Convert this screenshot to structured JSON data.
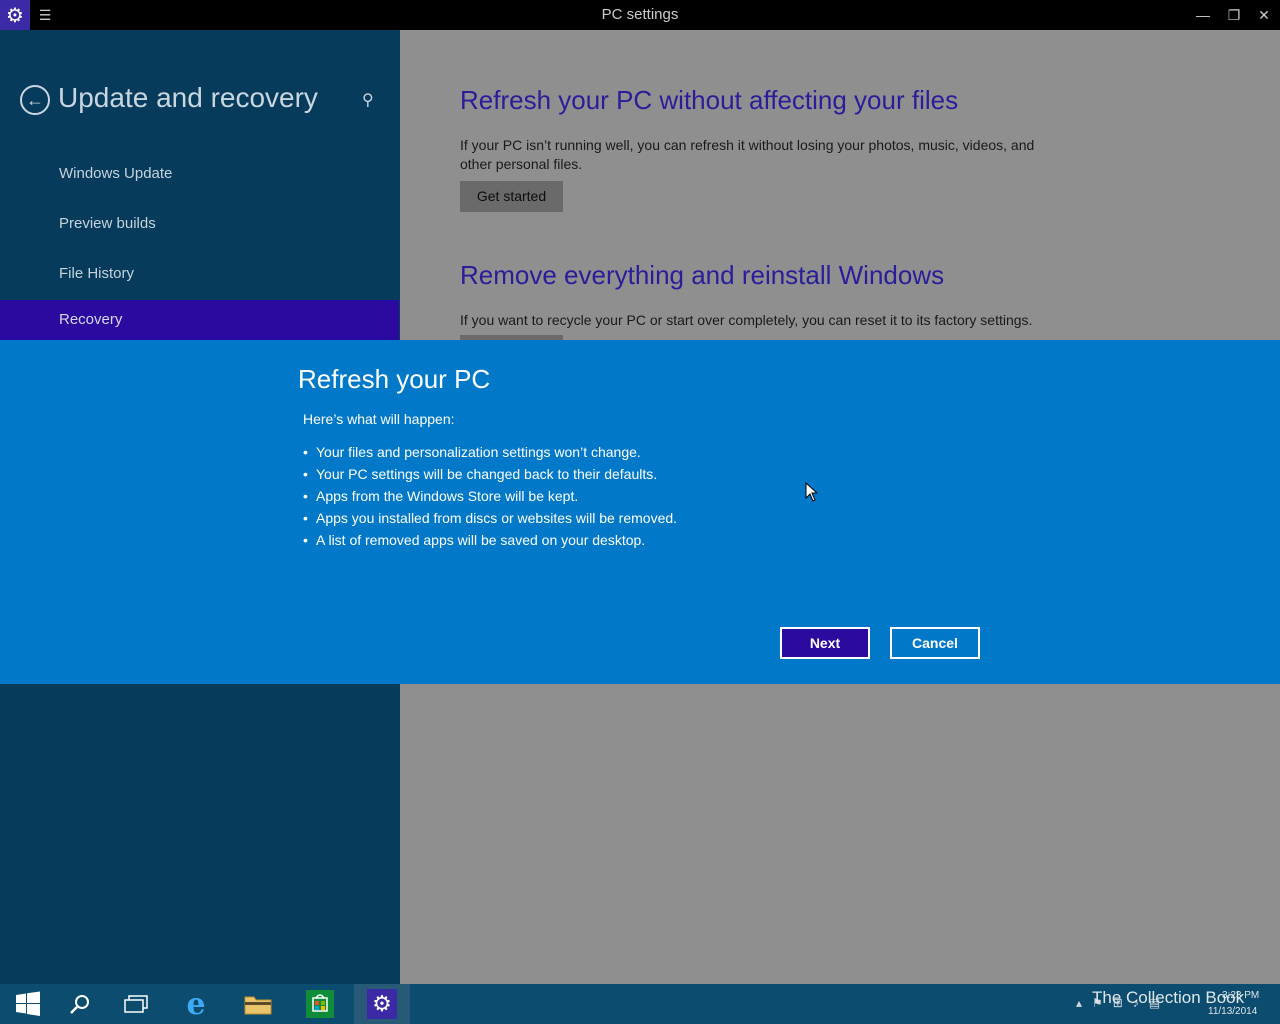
{
  "window": {
    "title": "PC settings",
    "minimize_label": "—",
    "restore_label": "❐",
    "close_label": "✕"
  },
  "sidebar": {
    "title": "Update and recovery",
    "items": [
      {
        "label": "Windows Update"
      },
      {
        "label": "Preview builds"
      },
      {
        "label": "File History"
      },
      {
        "label": "Recovery"
      }
    ],
    "active_index": 3
  },
  "content": {
    "sections": [
      {
        "heading": "Refresh your PC without affecting your files",
        "text": "If your PC isn’t running well, you can refresh it without losing your photos, music, videos, and other personal files.",
        "button": "Get started"
      },
      {
        "heading": "Remove everything and reinstall Windows",
        "text": "If you want to recycle your PC or start over completely, you can reset it to its factory settings."
      }
    ]
  },
  "dialog": {
    "title": "Refresh your PC",
    "subtitle": "Here’s what will happen:",
    "bullets": [
      "Your files and personalization settings won’t change.",
      "Your PC settings will be changed back to their defaults.",
      "Apps from the Windows Store will be kept.",
      "Apps you installed from discs or websites will be removed.",
      "A list of removed apps will be saved on your desktop."
    ],
    "next_label": "Next",
    "cancel_label": "Cancel"
  },
  "taskbar": {
    "items": [
      "start-icon",
      "search-icon",
      "task-view-icon",
      "internet-explorer-icon",
      "file-explorer-icon",
      "store-icon",
      "settings-icon"
    ],
    "active_item": "settings-icon",
    "watermark": "The Collection Book",
    "time": "3:23 PM",
    "date": "11/13/2014"
  },
  "colors": {
    "accent": "#2b0aa0",
    "dialog_bg": "#0278c8",
    "sidebar_bg": "#063b5c",
    "content_bg": "#8f8f8f",
    "heading": "#2a1d9a"
  }
}
